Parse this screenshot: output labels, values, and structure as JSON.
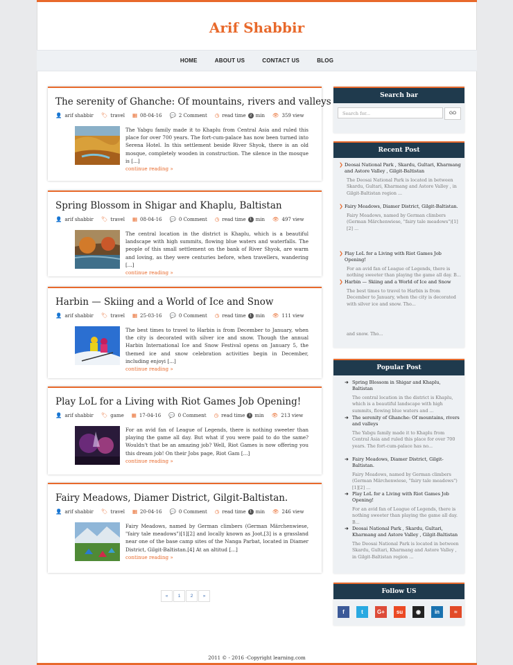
{
  "site": {
    "title": "Arif Shabbir"
  },
  "nav": [
    "HOME",
    "ABOUT US",
    "CONTACT US",
    "BLOG"
  ],
  "posts": [
    {
      "title": "The serenity of Ghanche: Of mountains, rivers and valleys",
      "author": "arif shabbir",
      "category": "travel",
      "date": "08-04-16",
      "comments": "2 Comment",
      "read_label": "read time",
      "read_min": "2",
      "min_label": "min",
      "views": "359 view",
      "excerpt": "The Yabgu family made it to Khaplu from Central Asia and ruled this place for over 700 years. The fort-cum-palace has now been turned into Serena Hotel. In this settlement beside River Shyok, there is an old mosque, completely wooden in construction. The silence in the mosque is [...]",
      "more": "continue reading »"
    },
    {
      "title": "Spring Blossom in Shigar and Khaplu, Baltistan",
      "author": "arif shabbir",
      "category": "travel",
      "date": "08-04-16",
      "comments": "0 Comment",
      "read_label": "read time",
      "read_min": "1",
      "min_label": "min",
      "views": "497 view",
      "excerpt": "The central location in the district is Khaplu, which is a beautiful landscape with high summits, flowing blue waters and waterfalls. The people of this small settlement on the bank of River Shyok, are warm and loving, as they were centuries before, when travellers, wandering [...]",
      "more": "continue reading »"
    },
    {
      "title": "Harbin — Skiing and a World of Ice and Snow",
      "author": "arif shabbir",
      "category": "travel",
      "date": "25-03-16",
      "comments": "0 Comment",
      "read_label": "read time",
      "read_min": "1",
      "min_label": "min",
      "views": "111 view",
      "excerpt": "The best times to travel to Harbin is from December to January, when the city is decorated with silver ice and snow. Though the annual Harbin International Ice and Snow Festival opens on January 5, the themed ice and snow celebration activities begin in December, including enjoyi [...]",
      "more": "continue reading »"
    },
    {
      "title": "Play LoL for a Living with Riot Games Job Opening!",
      "author": "arif shabbir",
      "category": "game",
      "date": "17-04-16",
      "comments": "0 Comment",
      "read_label": "read time",
      "read_min": "1",
      "min_label": "min",
      "views": "213 view",
      "excerpt": "For an avid fan of League of Legends, there is nothing sweeter than playing the game all day. But what if you were paid to do the same? Wouldn't that be an amazing job? Well, Riot Games is now offering you this dream job! On their Jobs page, Riot Gam [...]",
      "more": "continue reading »"
    },
    {
      "title": "Fairy Meadows, Diamer District, Gilgit-Baltistan.",
      "author": "arif shabbir",
      "category": "travel",
      "date": "20-04-16",
      "comments": "0 Comment",
      "read_label": "read time",
      "read_min": "1",
      "min_label": "min",
      "views": "246 view",
      "excerpt": "Fairy Meadows, named by German climbers (German Märchenwiese, \"fairy tale meadows\")[1][2] and locally known as Joot,[3] is a grassland near one of the base camp sites of the Nanga Parbat, located in Diamer District, Gilgit-Baltistan.[4] At an altitud [...]",
      "more": "continue reading »"
    }
  ],
  "pagination": [
    "«",
    "1",
    "2",
    "»"
  ],
  "search": {
    "title": "Search bar",
    "placeholder": "Search for...",
    "button": "GO"
  },
  "recent": {
    "title": "Recent Post",
    "items": [
      {
        "title": "Deosai National Park , Skardu, Gultari, Kharmang and Astore Valley , Gilgit-Baltistan",
        "desc": "The Deosai National Park is located in between Skardu, Gultari, Kharmang and Astore Valley , in Gilgit-Baltistan region ..."
      },
      {
        "title": "Fairy Meadows, Diamer District, Gilgit-Baltistan.",
        "desc": "Fairy Meadows, named by German climbers (German Märchenwiese, \"fairy tale meadows\")[1][2] ..."
      },
      {
        "title": "Play LoL for a Living with Riot Games Job Opening!",
        "desc": "For an avid fan of League of Legends, there is nothing sweeter than playing the game all day. B..."
      },
      {
        "title": "Harbin — Skiing and a World of Ice and Snow",
        "desc": "The best times to travel to Harbin is from December to January, when the city is decorated with silver ice and snow. Tho..."
      }
    ],
    "overflow": "and snow. Tho..."
  },
  "popular": {
    "title": "Popular Post",
    "items": [
      {
        "title": "Spring Blossom in Shigar and Khaplu, Baltistan",
        "desc": "The central location in the district is Khaplu, which is a beautiful landscape with high summits, flowing blue waters and ..."
      },
      {
        "title": "The serenity of Ghanche: Of mountains, rivers and valleys",
        "desc": "The Yabgu family made it to Khaplu from Central Asia and ruled this place for over 700 years. The fort-cum-palace has no..."
      },
      {
        "title": "Fairy Meadows, Diamer District, Gilgit-Baltistan.",
        "desc": "Fairy Meadows, named by German climbers (German Märchenwiese, \"fairy tale meadows\")[1][2] ..."
      },
      {
        "title": "Play LoL for a Living with Riot Games Job Opening!",
        "desc": "For an avid fan of League of Legends, there is nothing sweeter than playing the game all day. B..."
      },
      {
        "title": "Deosai National Park , Skardu, Gultari, Kharmang and Astore Valley , Gilgit-Baltistan",
        "desc": "The Deosai National Park is located in between Skardu, Gultari, Kharmang and Astore Valley , in Gilgit-Baltistan region ..."
      }
    ]
  },
  "follow": {
    "title": "Follow US",
    "icons": [
      {
        "name": "facebook-icon",
        "glyph": "f",
        "color": "#3b5998"
      },
      {
        "name": "twitter-icon",
        "glyph": "t",
        "color": "#29a9e1"
      },
      {
        "name": "google-plus-icon",
        "glyph": "G+",
        "color": "#dd4b39"
      },
      {
        "name": "stumbleupon-icon",
        "glyph": "su",
        "color": "#eb4924"
      },
      {
        "name": "github-icon",
        "glyph": "◉",
        "color": "#222222"
      },
      {
        "name": "linkedin-icon",
        "glyph": "in",
        "color": "#1a72b0"
      },
      {
        "name": "rss-icon",
        "glyph": "≈",
        "color": "#e24a28"
      }
    ]
  },
  "footer": {
    "text": "2011 © - 2016 -Copyright learning.com"
  },
  "colors": {
    "accent": "#e8692b",
    "widget_header": "#1f3a4d"
  }
}
